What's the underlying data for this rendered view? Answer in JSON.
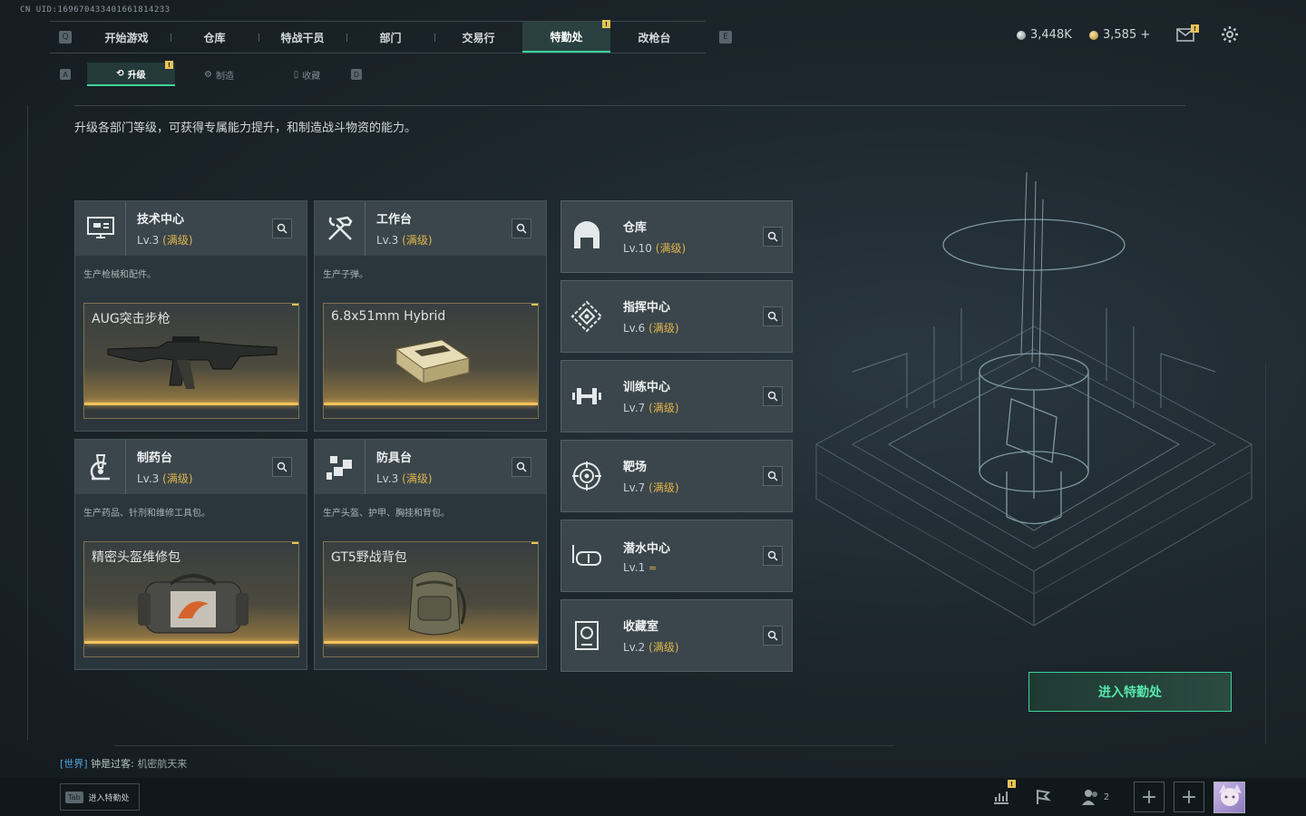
{
  "uid": "CN UID:169670433401661814233",
  "nav": {
    "q_key": "Q",
    "e_key": "E",
    "tabs": [
      "开始游戏",
      "仓库",
      "特战干员",
      "部门",
      "交易行",
      "特勤处",
      "改枪台"
    ],
    "active_tab": "特勤处",
    "badge_label": "!"
  },
  "currency": {
    "silver": "3,448K",
    "gold": "3,585 +"
  },
  "subnav": {
    "a_key": "A",
    "d_key": "D",
    "tabs": [
      "升级",
      "制造",
      "收藏"
    ],
    "active_tab": "升级"
  },
  "intro": "升级各部门等级，可获得专属能力提升，和制造战斗物资的能力。",
  "cards": [
    {
      "title": "技术中心",
      "level": "Lv.3",
      "max": "(满级)",
      "desc": "生产枪械和配件。",
      "product": "AUG突击步枪",
      "icon": "monitor-icon"
    },
    {
      "title": "工作台",
      "level": "Lv.3",
      "max": "(满级)",
      "desc": "生产子弹。",
      "product": "6.8x51mm Hybrid",
      "icon": "hammer-wrench-icon"
    },
    {
      "title": "制药台",
      "level": "Lv.3",
      "max": "(满级)",
      "desc": "生产药品、针剂和维修工具包。",
      "product": "精密头盔维修包",
      "icon": "microscope-icon"
    },
    {
      "title": "防具台",
      "level": "Lv.3",
      "max": "(满级)",
      "desc": "生产头盔、护甲、胸挂和背包。",
      "product": "GT5野战背包",
      "icon": "cubes-icon"
    }
  ],
  "list": [
    {
      "title": "仓库",
      "level": "Lv.10",
      "max": "(满级)",
      "icon": "warehouse-icon"
    },
    {
      "title": "指挥中心",
      "level": "Lv.6",
      "max": "(满级)",
      "icon": "command-icon"
    },
    {
      "title": "训练中心",
      "level": "Lv.7",
      "max": "(满级)",
      "icon": "dumbbell-icon"
    },
    {
      "title": "靶场",
      "level": "Lv.7",
      "max": "(满级)",
      "icon": "target-icon"
    },
    {
      "title": "潜水中心",
      "level": "Lv.1",
      "max": "",
      "upgrade": "≈",
      "icon": "diving-mask-icon"
    },
    {
      "title": "收藏室",
      "level": "Lv.2",
      "max": "(满级)",
      "icon": "collection-icon"
    }
  ],
  "enter_button": "进入特勤处",
  "chat": {
    "channel": "[世界]",
    "user": "钟是过客:",
    "message": "机密航天来"
  },
  "bottom": {
    "tab_key": "Tab",
    "tab_label": "进入特勤处",
    "friends_count": "2"
  }
}
